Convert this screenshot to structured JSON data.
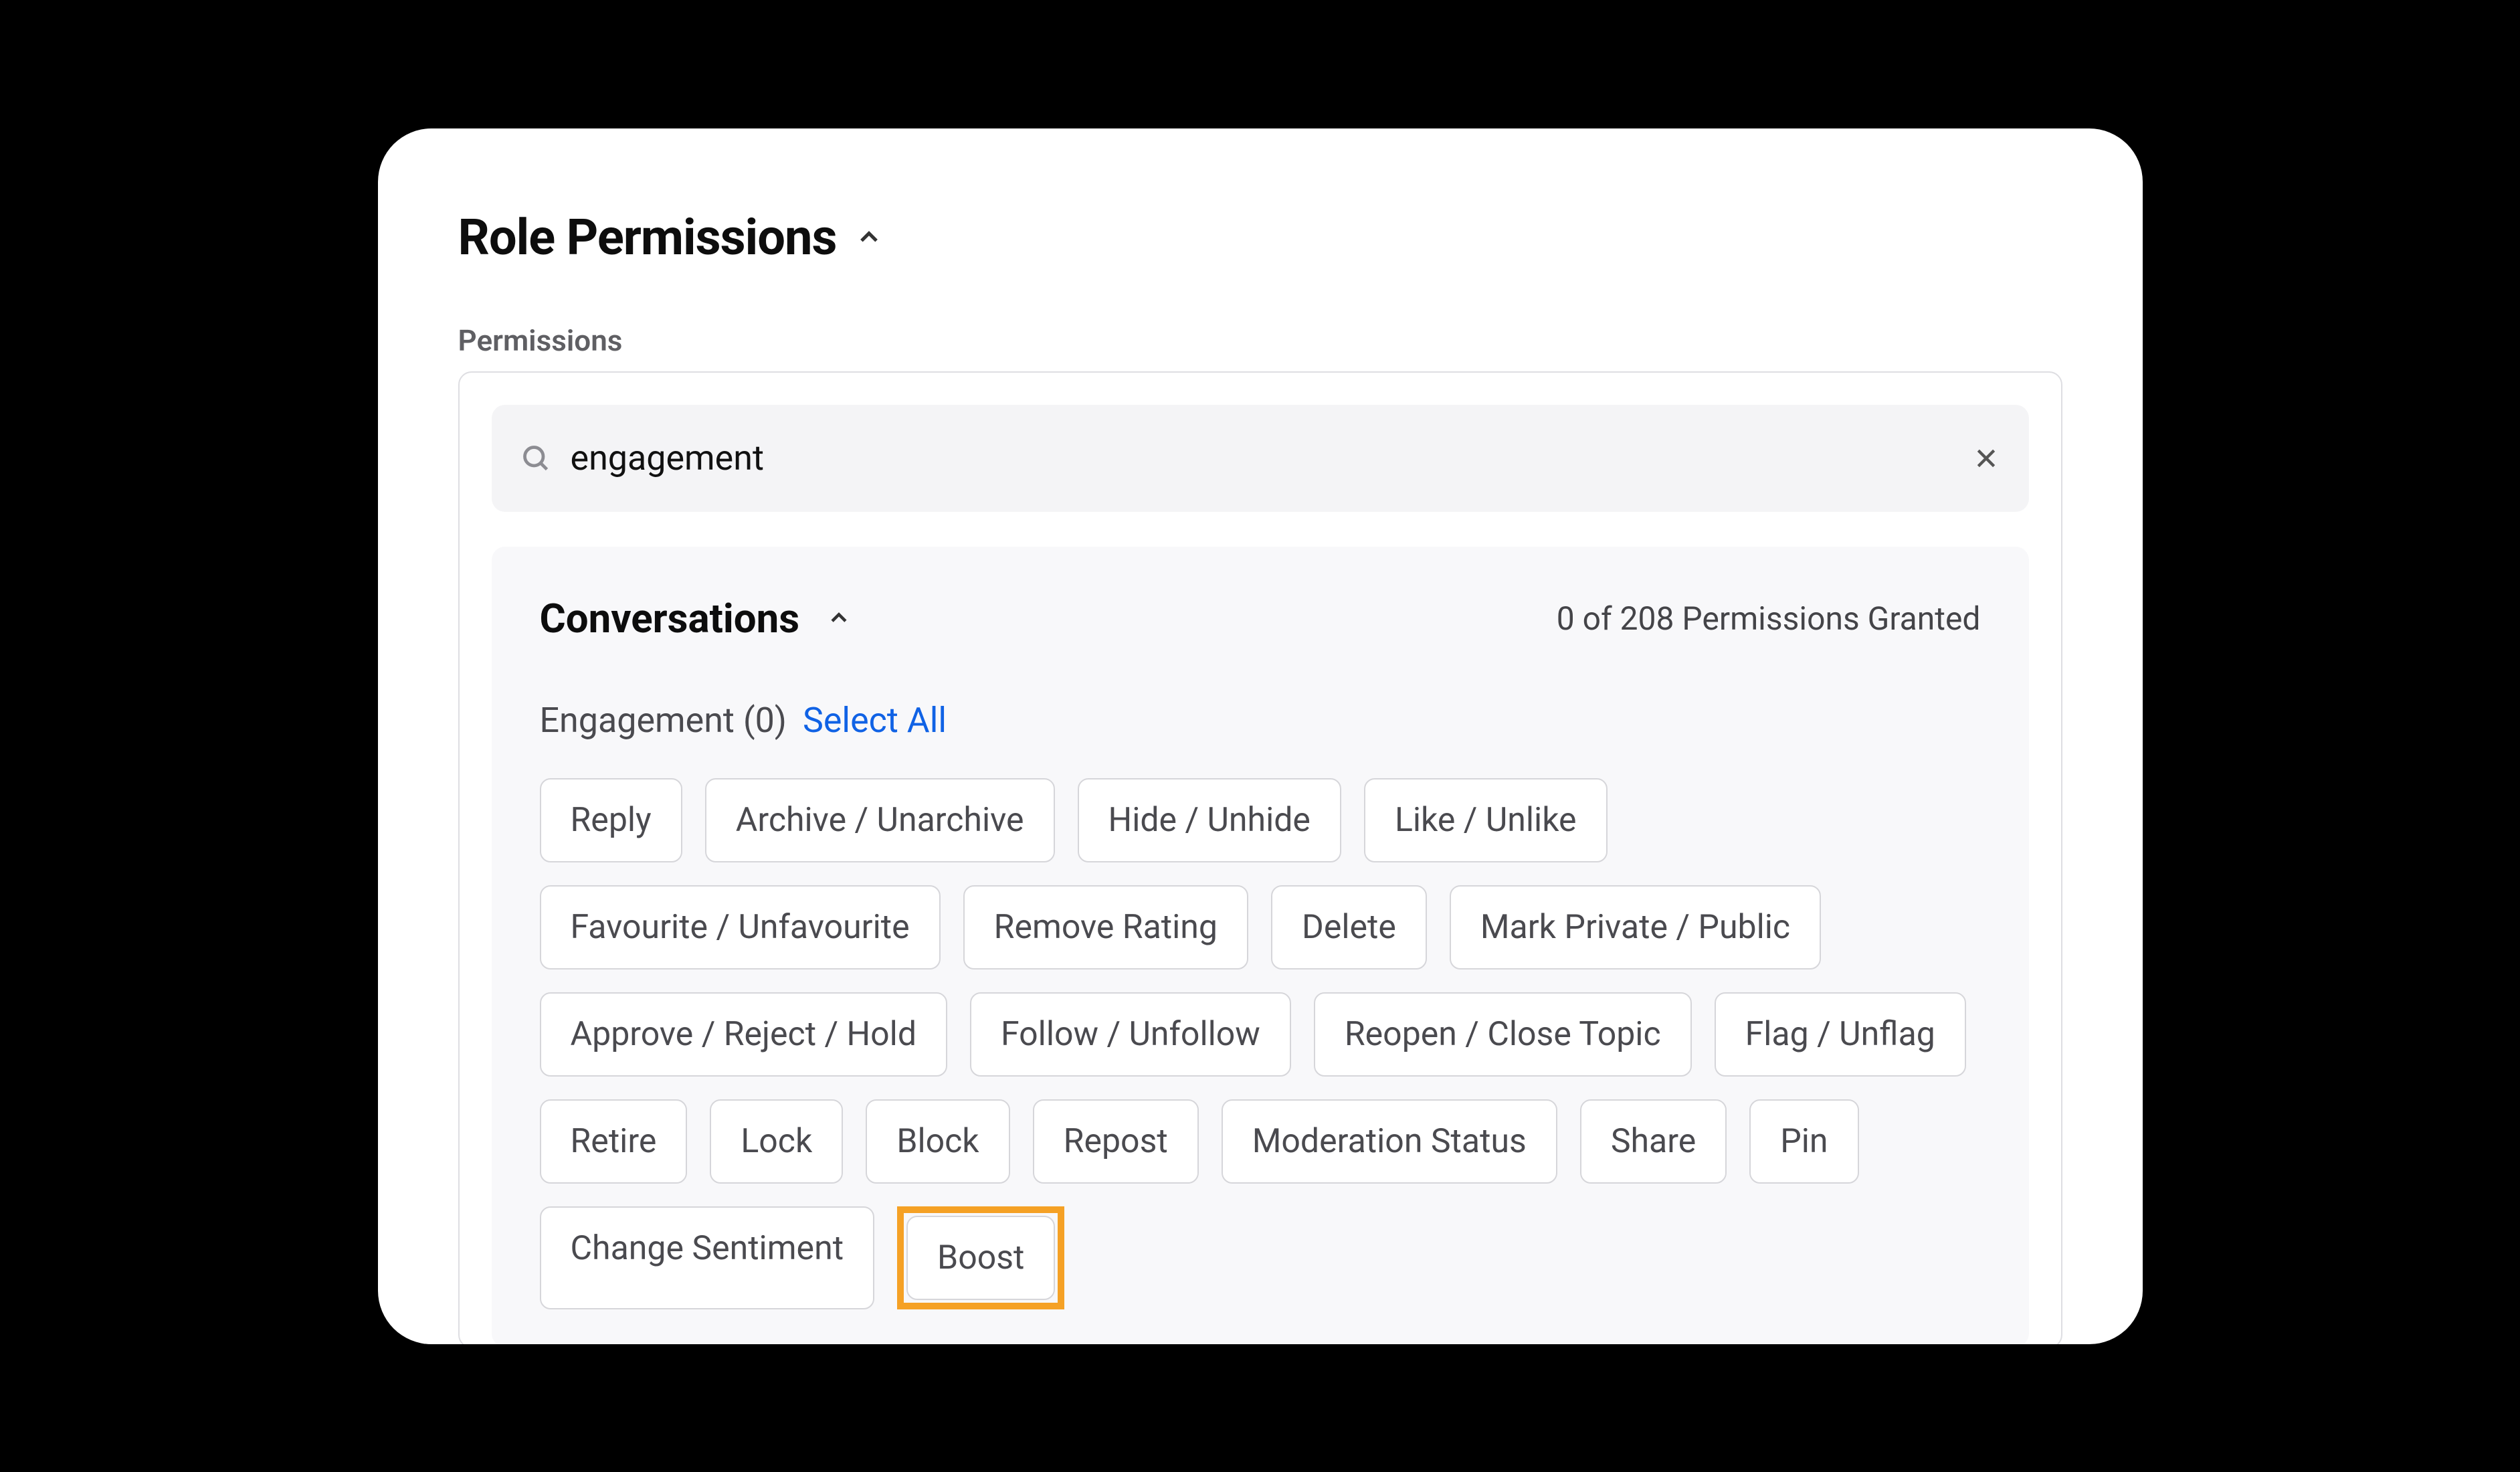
{
  "header": {
    "title": "Role Permissions",
    "sublabel": "Permissions"
  },
  "search": {
    "value": "engagement",
    "placeholder": ""
  },
  "group": {
    "title": "Conversations",
    "grant_status": "0 of 208 Permissions Granted",
    "subgroup_label": "Engagement (0)",
    "select_all": "Select All"
  },
  "chips": [
    {
      "label": "Reply",
      "highlighted": false
    },
    {
      "label": "Archive / Unarchive",
      "highlighted": false
    },
    {
      "label": "Hide / Unhide",
      "highlighted": false
    },
    {
      "label": "Like / Unlike",
      "highlighted": false
    },
    {
      "label": "Favourite / Unfavourite",
      "highlighted": false
    },
    {
      "label": "Remove Rating",
      "highlighted": false
    },
    {
      "label": "Delete",
      "highlighted": false
    },
    {
      "label": "Mark Private / Public",
      "highlighted": false
    },
    {
      "label": "Approve / Reject / Hold",
      "highlighted": false
    },
    {
      "label": "Follow / Unfollow",
      "highlighted": false
    },
    {
      "label": "Reopen / Close Topic",
      "highlighted": false
    },
    {
      "label": "Flag / Unflag",
      "highlighted": false
    },
    {
      "label": "Retire",
      "highlighted": false
    },
    {
      "label": "Lock",
      "highlighted": false
    },
    {
      "label": "Block",
      "highlighted": false
    },
    {
      "label": "Repost",
      "highlighted": false
    },
    {
      "label": "Moderation Status",
      "highlighted": false
    },
    {
      "label": "Share",
      "highlighted": false
    },
    {
      "label": "Pin",
      "highlighted": false
    },
    {
      "label": "Change Sentiment",
      "highlighted": false
    },
    {
      "label": "Boost",
      "highlighted": true
    }
  ]
}
